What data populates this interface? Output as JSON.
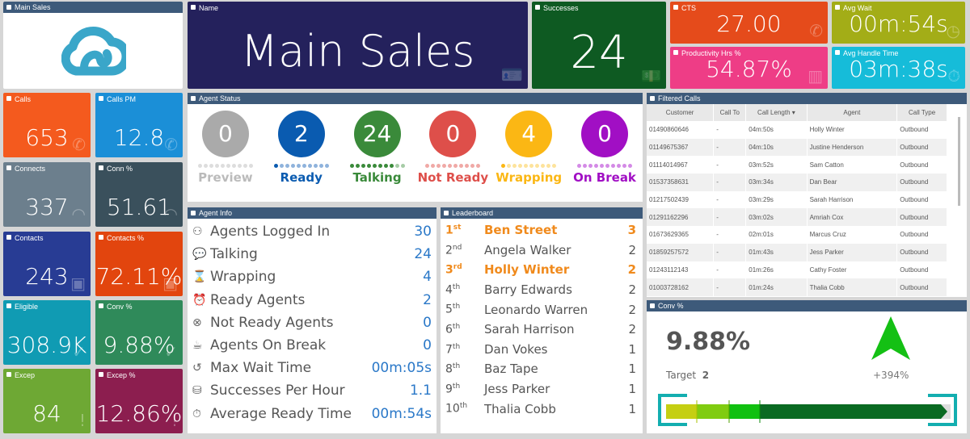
{
  "logo_tile": {
    "title": "Main Sales"
  },
  "name_tile": {
    "title": "Name",
    "value": "Main Sales"
  },
  "kpis": [
    {
      "title": "Successes",
      "value": "24",
      "color": "#0e5a22",
      "icon": "money-icon"
    },
    {
      "title": "CTS",
      "value": "27.00",
      "color": "#e54b1b",
      "icon": "phone-icon"
    },
    {
      "title": "Avg Wait",
      "value": "00m:54s",
      "color": "#a3ad17",
      "icon": "clock-icon"
    },
    {
      "title": "Productivity Hrs %",
      "value": "54.87%",
      "color": "#ee3d86",
      "icon": "chart-icon"
    },
    {
      "title": "Avg Handle Time",
      "value": "03m:38s",
      "color": "#16bcd9",
      "icon": "stopwatch-icon"
    }
  ],
  "small_tiles": [
    {
      "title": "Calls",
      "value": "653",
      "color": "#f45a1e",
      "icon": "phone-icon"
    },
    {
      "title": "Calls PM",
      "value": "12.8",
      "color": "#1b8fd7",
      "icon": "phone-icon"
    },
    {
      "title": "Connects",
      "value": "337",
      "color": "#6c7f8d",
      "icon": "wifi-icon"
    },
    {
      "title": "Conn %",
      "value": "51.61",
      "color": "#3a505c",
      "icon": "wifi-icon"
    },
    {
      "title": "Contacts",
      "value": "243",
      "color": "#283c94",
      "icon": "contact-icon"
    },
    {
      "title": "Contacts %",
      "value": "72.11%",
      "color": "#e2450e",
      "icon": "contact-icon"
    },
    {
      "title": "Eligible",
      "value": "308.9K",
      "color": "#109bb3",
      "icon": "check-icon"
    },
    {
      "title": "Conv %",
      "value": "9.88%",
      "color": "#2f8a5a",
      "icon": "check-icon"
    },
    {
      "title": "Excep",
      "value": "84",
      "color": "#6ea834",
      "icon": "alert-icon"
    },
    {
      "title": "Excep %",
      "value": "12.86%",
      "color": "#8c1e4f",
      "icon": "alert-icon"
    }
  ],
  "agent_status": {
    "title": "Agent Status",
    "items": [
      {
        "label": "Preview",
        "value": "0",
        "color": "#aaaaaa",
        "light": "#dddddd",
        "filled": 0
      },
      {
        "label": "Ready",
        "value": "2",
        "color": "#0a5bb0",
        "light": "#8fb3dc",
        "filled": 1
      },
      {
        "label": "Talking",
        "value": "24",
        "color": "#3a8a3a",
        "light": "#a6cca6",
        "filled": 8
      },
      {
        "label": "Not Ready",
        "value": "0",
        "color": "#de4f4a",
        "light": "#f0a9a6",
        "filled": 0
      },
      {
        "label": "Wrapping",
        "value": "4",
        "color": "#fbb714",
        "light": "#fde39c",
        "filled": 1
      },
      {
        "label": "On Break",
        "value": "0",
        "color": "#a10fc4",
        "light": "#d48ae6",
        "filled": 0
      }
    ]
  },
  "agent_info": {
    "title": "Agent Info",
    "rows": [
      {
        "icon": "users-icon",
        "glyph": "⚇",
        "label": "Agents Logged In",
        "value": "30"
      },
      {
        "icon": "chat-icon",
        "glyph": "💬",
        "label": "Talking",
        "value": "24"
      },
      {
        "icon": "hourglass-icon",
        "glyph": "⌛",
        "label": "Wrapping",
        "value": "4"
      },
      {
        "icon": "alarm-icon",
        "glyph": "⏰",
        "label": "Ready Agents",
        "value": "2"
      },
      {
        "icon": "cancel-icon",
        "glyph": "⊗",
        "label": "Not Ready Agents",
        "value": "0"
      },
      {
        "icon": "coffee-icon",
        "glyph": "☕",
        "label": "Agents On Break",
        "value": "0"
      },
      {
        "icon": "history-icon",
        "glyph": "↺",
        "label": "Max Wait Time",
        "value": "00m:05s"
      },
      {
        "icon": "coins-icon",
        "glyph": "⛁",
        "label": "Successes Per Hour",
        "value": "1.1"
      },
      {
        "icon": "stopwatch-icon",
        "glyph": "⏱",
        "label": "Average Ready Time",
        "value": "00m:54s"
      }
    ]
  },
  "leaderboard": {
    "title": "Leaderboard",
    "rows": [
      {
        "rank": "1",
        "suffix": "st",
        "name": "Ben Street",
        "value": "3",
        "top": true
      },
      {
        "rank": "2",
        "suffix": "nd",
        "name": "Angela Walker",
        "value": "2",
        "top": false
      },
      {
        "rank": "3",
        "suffix": "rd",
        "name": "Holly Winter",
        "value": "2",
        "top": true
      },
      {
        "rank": "4",
        "suffix": "th",
        "name": "Barry Edwards",
        "value": "2",
        "top": false
      },
      {
        "rank": "5",
        "suffix": "th",
        "name": "Leonardo Warren",
        "value": "2",
        "top": false
      },
      {
        "rank": "6",
        "suffix": "th",
        "name": "Sarah Harrison",
        "value": "2",
        "top": false
      },
      {
        "rank": "7",
        "suffix": "th",
        "name": "Dan Vokes",
        "value": "1",
        "top": false
      },
      {
        "rank": "8",
        "suffix": "th",
        "name": "Baz Tape",
        "value": "1",
        "top": false
      },
      {
        "rank": "9",
        "suffix": "th",
        "name": "Jess Parker",
        "value": "1",
        "top": false
      },
      {
        "rank": "10",
        "suffix": "th",
        "name": "Thalia Cobb",
        "value": "1",
        "top": false
      }
    ]
  },
  "filtered_calls": {
    "title": "Filtered Calls",
    "columns": [
      "Customer",
      "Call To",
      "Call Length ▾",
      "Agent",
      "Call Type"
    ],
    "rows": [
      [
        "01490860646",
        "-",
        "04m:50s",
        "Holly Winter",
        "Outbound"
      ],
      [
        "01149675367",
        "-",
        "04m:10s",
        "Justine Henderson",
        "Outbound"
      ],
      [
        "01114014967",
        "-",
        "03m:52s",
        "Sam Catton",
        "Outbound"
      ],
      [
        "01537358631",
        "-",
        "03m:34s",
        "Dan Bear",
        "Outbound"
      ],
      [
        "01217502439",
        "-",
        "03m:29s",
        "Sarah Harrison",
        "Outbound"
      ],
      [
        "01291162296",
        "-",
        "03m:02s",
        "Amriah Cox",
        "Outbound"
      ],
      [
        "01673629365",
        "-",
        "02m:01s",
        "Marcus Cruz",
        "Outbound"
      ],
      [
        "01859257572",
        "-",
        "01m:43s",
        "Jess Parker",
        "Outbound"
      ],
      [
        "01243112143",
        "-",
        "01m:26s",
        "Cathy Foster",
        "Outbound"
      ],
      [
        "01003728162",
        "-",
        "01m:24s",
        "Thalia Cobb",
        "Outbound"
      ]
    ]
  },
  "conv_panel": {
    "title": "Conv %",
    "value": "9.88%",
    "target_label": "Target",
    "target": "2",
    "change": "+394%",
    "trend": "up"
  }
}
